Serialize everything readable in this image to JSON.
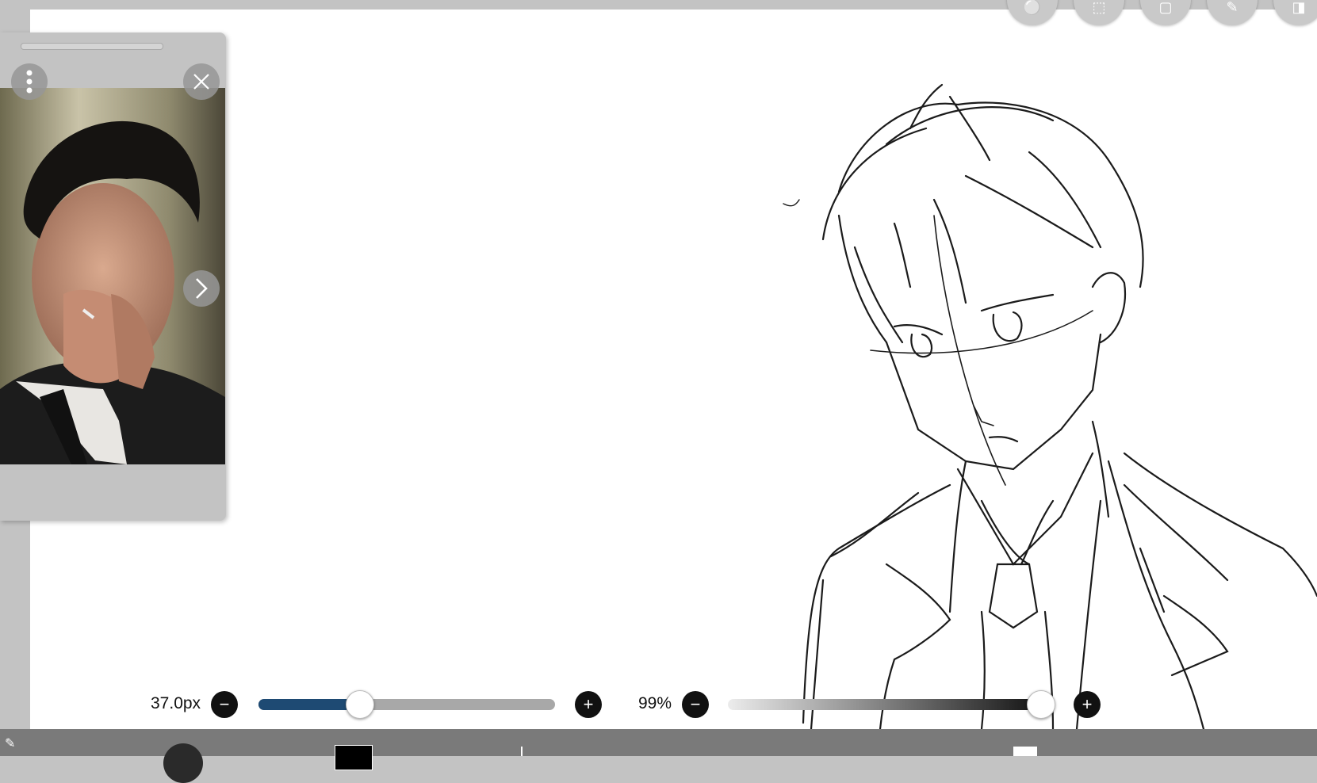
{
  "toolbar": {
    "buttons": [
      {
        "name": "toggle-icon",
        "glyph": "⚪"
      },
      {
        "name": "selection-icon",
        "glyph": "⬚"
      },
      {
        "name": "transform-icon",
        "glyph": "▢"
      },
      {
        "name": "ruler-icon",
        "glyph": "✎"
      },
      {
        "name": "layer-icon",
        "glyph": "◨"
      }
    ]
  },
  "reference_window": {
    "menu_icon": "more-vertical-icon",
    "close_icon": "close-icon",
    "next_icon": "chevron-right-icon"
  },
  "brush": {
    "size_label": "37.0px",
    "size_fraction": 0.34,
    "minus": "−",
    "plus": "+"
  },
  "opacity": {
    "label": "99%",
    "fraction": 0.99,
    "minus": "−",
    "plus": "+"
  },
  "colors": {
    "accent": "#1e4a73",
    "panel": "#c3c3c3",
    "bottom_bar": "#7a7a7a"
  }
}
